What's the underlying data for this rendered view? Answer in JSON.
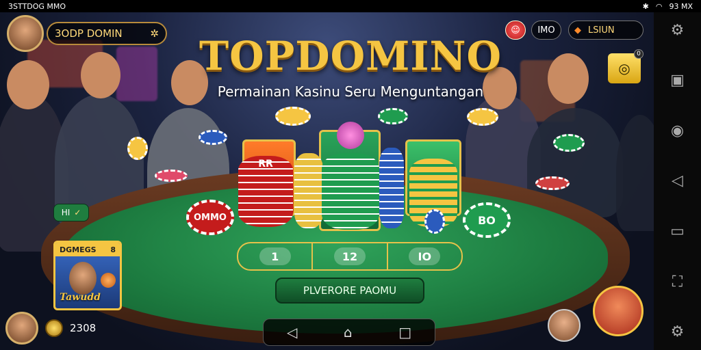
{
  "status": {
    "left_text": "3STTDOG MMO",
    "right_text": "93 MX",
    "bluetooth_icon": "bluetooth-icon",
    "wifi_icon": "wifi-icon"
  },
  "profile": {
    "name": "3ODP DOMIN",
    "avatar_icon": "avatar-icon",
    "settings_icon": "settings-icon"
  },
  "title": "TOPDOMINO",
  "subtitle": "Permainan Kasinu Seru Menguntangan",
  "top_right": {
    "counter": "IMO",
    "bonus_label": "LSIUN",
    "gift_badge": "0"
  },
  "table": {
    "chip_left": "OMMO",
    "chip_center_label": "RR",
    "chip_right": "BO",
    "small_pill": "HI",
    "bet_zones": [
      "1",
      "12",
      "IO"
    ],
    "play_button": "PLVERORE PAOMU"
  },
  "promo": {
    "label": "DGMEGS",
    "badge": "8",
    "caption": "Tawudd"
  },
  "bottom_left": {
    "coins": "2308"
  },
  "navbar": {
    "back": "◁",
    "home": "⌂",
    "recent": "□"
  },
  "right_nav": [
    "gear-icon",
    "square-icon",
    "badge-icon",
    "back-icon",
    "minus-icon",
    "screenshot-icon",
    "settings-icon"
  ],
  "colors": {
    "accent_gold": "#f5c542",
    "felt_green": "#1c7a3f",
    "play_button": "#1f7d3f"
  }
}
